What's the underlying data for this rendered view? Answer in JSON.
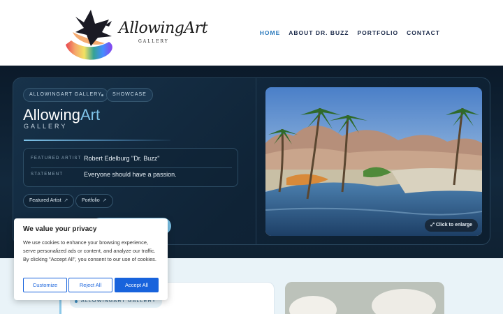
{
  "header": {
    "logo_text": "AllowingArt",
    "logo_subtext": "GALLERY",
    "nav": [
      "HOME",
      "ABOUT DR. BUZZ",
      "PORTFOLIO",
      "CONTACT"
    ],
    "active_nav": "HOME",
    "colors": {
      "nav": "#1b2a4a",
      "nav_active": "#2d7bbd"
    }
  },
  "hero": {
    "chips": [
      "ALLOWINGART GALLERY",
      "SHOWCASE"
    ],
    "title_main": "Allowing",
    "title_accent": "Art",
    "subtitle": "GALLERY",
    "info": [
      {
        "key": "FEATURED ARTIST",
        "value": "Robert Edelburg \"Dr. Buzz\""
      },
      {
        "key": "STATEMENT",
        "value": "Everyone should have a passion."
      }
    ],
    "links": [
      {
        "label": "Featured Artist",
        "icon": "external-arrow-icon"
      },
      {
        "label": "Portfolio",
        "icon": "external-arrow-icon"
      }
    ],
    "enlarge_label": "Click to enlarge",
    "enlarge_icon": "expand-icon",
    "painting": "desert oasis painting with palm trees, mountains and reflecting water"
  },
  "lower": {
    "chip": "ALLOWINGART GALLERY"
  },
  "cookie": {
    "title": "We value your privacy",
    "text": "We use cookies to enhance your browsing experience, serve personalized ads or content, and analyze our traffic. By clicking \"Accept All\", you consent to our use of cookies.",
    "buttons": [
      "Customize",
      "Reject All",
      "Accept All"
    ],
    "accent": "#1863dc"
  }
}
